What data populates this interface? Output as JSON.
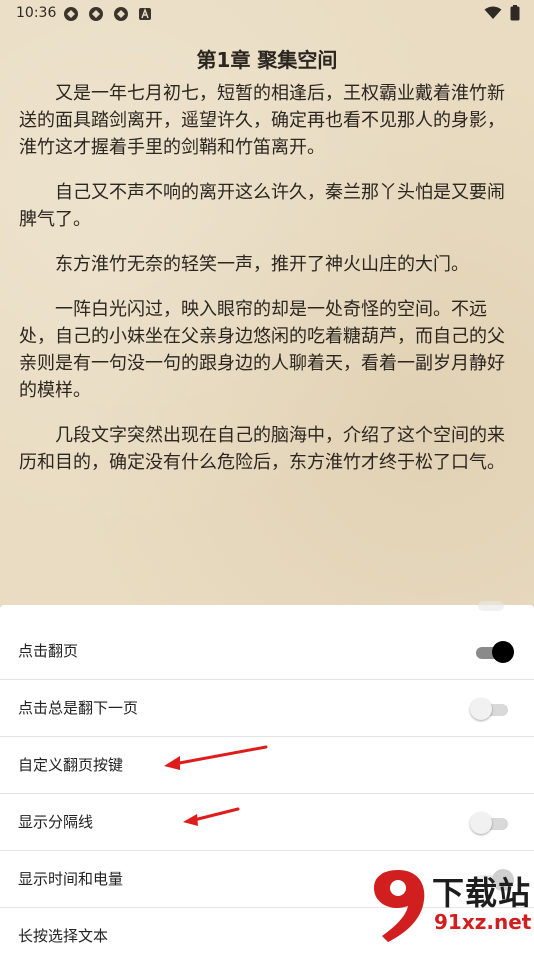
{
  "status_bar": {
    "time": "10:36",
    "icons": [
      "sync-icon",
      "sync-icon",
      "sync-icon",
      "text-a-icon"
    ],
    "right_icons": [
      "wifi-icon",
      "battery-icon"
    ]
  },
  "chapter": {
    "title": "第1章 聚集空间",
    "paragraphs": [
      "又是一年七月初七，短暂的相逢后，王权霸业戴着淮竹新送的面具踏剑离开，遥望许久，确定再也看不见那人的身影，淮竹这才握着手里的剑鞘和竹笛离开。",
      "自己又不声不响的离开这么许久，秦兰那丫头怕是又要闹脾气了。",
      "东方淮竹无奈的轻笑一声，推开了神火山庄的大门。",
      "一阵白光闪过，映入眼帘的却是一处奇怪的空间。不远处，自己的小妹坐在父亲身边悠闲的吃着糖葫芦，而自己的父亲则是有一句没一句的跟身边的人聊着天，看着一副岁月静好的模样。",
      "几段文字突然出现在自己的脑海中，介绍了这个空间的来历和目的，确定没有什么危险后，东方淮竹才终于松了口气。"
    ]
  },
  "settings": {
    "rows": [
      {
        "label": "点击翻页",
        "toggle": "on"
      },
      {
        "label": "点击总是翻下一页",
        "toggle": "off"
      },
      {
        "label": "自定义翻页按键",
        "toggle": "none"
      },
      {
        "label": "显示分隔线",
        "toggle": "off"
      },
      {
        "label": "显示时间和电量",
        "toggle": "faded"
      },
      {
        "label": "长按选择文本",
        "toggle": "hidden"
      }
    ]
  },
  "watermark": {
    "logo": "9f",
    "brand": "下载站",
    "url": "91xz.net"
  },
  "colors": {
    "paper": "#e9dcc2",
    "text": "#2b2620",
    "arrow": "#e01b1b",
    "watermark_red": "#d11f1f"
  }
}
